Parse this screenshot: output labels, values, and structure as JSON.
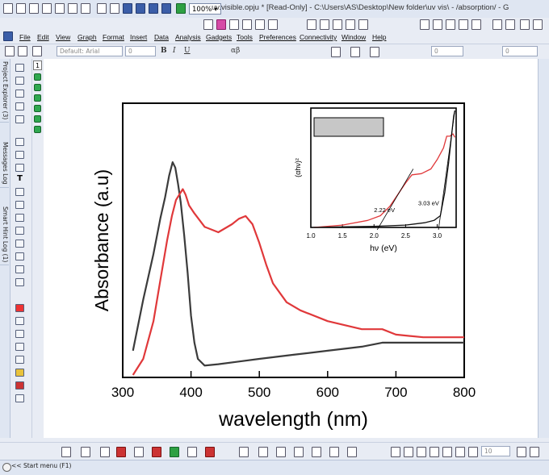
{
  "window": {
    "title": "uv.visible.opju * [Read-Only] - C:\\Users\\AS\\Desktop\\New folder\\uv vis\\ - /absorption/ - G",
    "zoom": "100%"
  },
  "menu": [
    "File",
    "Edit",
    "View",
    "Graph",
    "Format",
    "Insert",
    "Data",
    "Analysis",
    "Gadgets",
    "Tools",
    "Preferences",
    "Connectivity",
    "Window",
    "Help"
  ],
  "format_toolbar": {
    "font": "Default: Arial",
    "font_size": "0",
    "bold": "B",
    "italic": "I",
    "underline": "U",
    "greek": "αβ",
    "line_width": "0",
    "pattern_size": "0"
  },
  "side_tabs": [
    "Project Explorer (3)",
    "Messages Log",
    "Smart Hint Log (1)"
  ],
  "layer_number": "1",
  "bottom_toolbar": {
    "size_value": "10"
  },
  "status": {
    "start_menu": "<< Start menu (F1)"
  },
  "chart_data": [
    {
      "type": "line",
      "xlabel": "wavelength (nm)",
      "ylabel": "Absorbance (a.u)",
      "xlim": [
        300,
        800
      ],
      "xticks": [
        "300",
        "400",
        "500",
        "600",
        "700",
        "800"
      ],
      "y_tick_labels_shown": false,
      "series": [
        {
          "color": "#3b3b3b",
          "x": [
            315,
            330,
            345,
            355,
            362,
            368,
            373,
            377,
            381,
            385,
            390,
            395,
            400,
            405,
            410,
            420,
            440,
            470,
            500,
            550,
            600,
            650,
            680,
            700,
            740,
            800
          ],
          "y": [
            0.09,
            0.28,
            0.45,
            0.58,
            0.66,
            0.74,
            0.79,
            0.77,
            0.71,
            0.64,
            0.52,
            0.38,
            0.22,
            0.12,
            0.06,
            0.035,
            0.04,
            0.05,
            0.06,
            0.075,
            0.09,
            0.105,
            0.12,
            0.12,
            0.12,
            0.12
          ]
        },
        {
          "color": "#e0383a",
          "x": [
            315,
            330,
            345,
            355,
            365,
            372,
            378,
            383,
            388,
            392,
            397,
            405,
            420,
            440,
            460,
            470,
            480,
            490,
            500,
            510,
            520,
            540,
            560,
            600,
            650,
            680,
            700,
            740,
            800
          ],
          "y": [
            0.0,
            0.06,
            0.2,
            0.35,
            0.5,
            0.59,
            0.65,
            0.67,
            0.69,
            0.67,
            0.63,
            0.6,
            0.55,
            0.53,
            0.56,
            0.58,
            0.59,
            0.56,
            0.49,
            0.41,
            0.34,
            0.27,
            0.24,
            0.2,
            0.17,
            0.17,
            0.15,
            0.14,
            0.14
          ]
        }
      ]
    },
    {
      "type": "line",
      "xlabel": "hν (eV)",
      "ylabel": "(αhν)²",
      "xlim": [
        1.0,
        3.3
      ],
      "xticks": [
        "1.0",
        "1.5",
        "2.0",
        "2.5",
        "3.0"
      ],
      "annotations": [
        "2.22 eV",
        "3.03 eV"
      ],
      "series": [
        {
          "color": "#e0383a",
          "x": [
            1.05,
            1.5,
            1.9,
            2.1,
            2.25,
            2.35,
            2.5,
            2.6,
            2.75,
            2.9,
            3.0,
            3.1,
            3.15,
            3.2,
            3.25,
            3.28
          ],
          "y": [
            0.0,
            0.02,
            0.06,
            0.1,
            0.18,
            0.26,
            0.38,
            0.45,
            0.46,
            0.5,
            0.58,
            0.68,
            0.78,
            0.78,
            0.8,
            0.77
          ]
        },
        {
          "color": "#111111",
          "x": [
            1.05,
            1.5,
            2.0,
            2.5,
            2.8,
            2.95,
            3.05,
            3.12,
            3.18,
            3.22,
            3.26,
            3.28
          ],
          "y": [
            0.0,
            0.005,
            0.01,
            0.02,
            0.04,
            0.06,
            0.1,
            0.3,
            0.55,
            0.75,
            0.95,
            1.0
          ]
        }
      ]
    }
  ]
}
